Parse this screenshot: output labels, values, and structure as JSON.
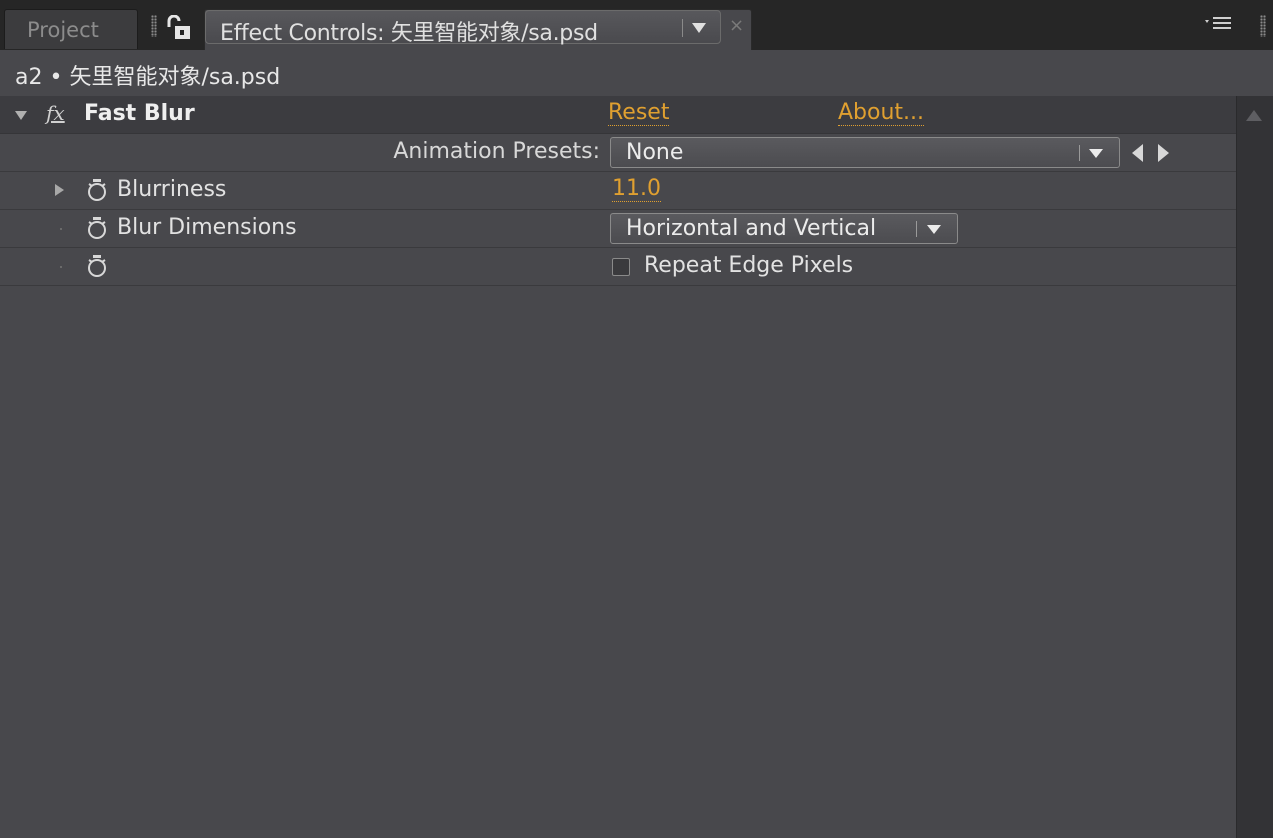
{
  "tabs": {
    "project_label": "Project",
    "effect_controls_label": "Effect Controls: 矢里智能对象/sa.psd",
    "close_glyph": "×"
  },
  "header": {
    "title": "a2 • 矢里智能对象/sa.psd"
  },
  "effect": {
    "name": "Fast Blur",
    "reset_label": "Reset",
    "about_label": "About...",
    "presets_label": "Animation Presets:",
    "presets_value": "None"
  },
  "properties": {
    "blurriness": {
      "label": "Blurriness",
      "value": "11.0"
    },
    "blur_dimensions": {
      "label": "Blur Dimensions",
      "value": "Horizontal and Vertical"
    },
    "repeat_edge": {
      "label": "Repeat Edge Pixels",
      "checked": false
    }
  },
  "colors": {
    "panel_bg": "#48484c",
    "tabbar_bg": "#262626",
    "link_orange": "#e0a030",
    "text": "#e2e2e2"
  },
  "icons": [
    "lock-icon",
    "panel-menu-icon",
    "fx-icon",
    "stopwatch-icon",
    "dropdown-arrow-icon",
    "twirl-down-icon",
    "twirl-right-icon",
    "prev-keyframe-icon",
    "next-keyframe-icon",
    "scroll-up-icon"
  ]
}
